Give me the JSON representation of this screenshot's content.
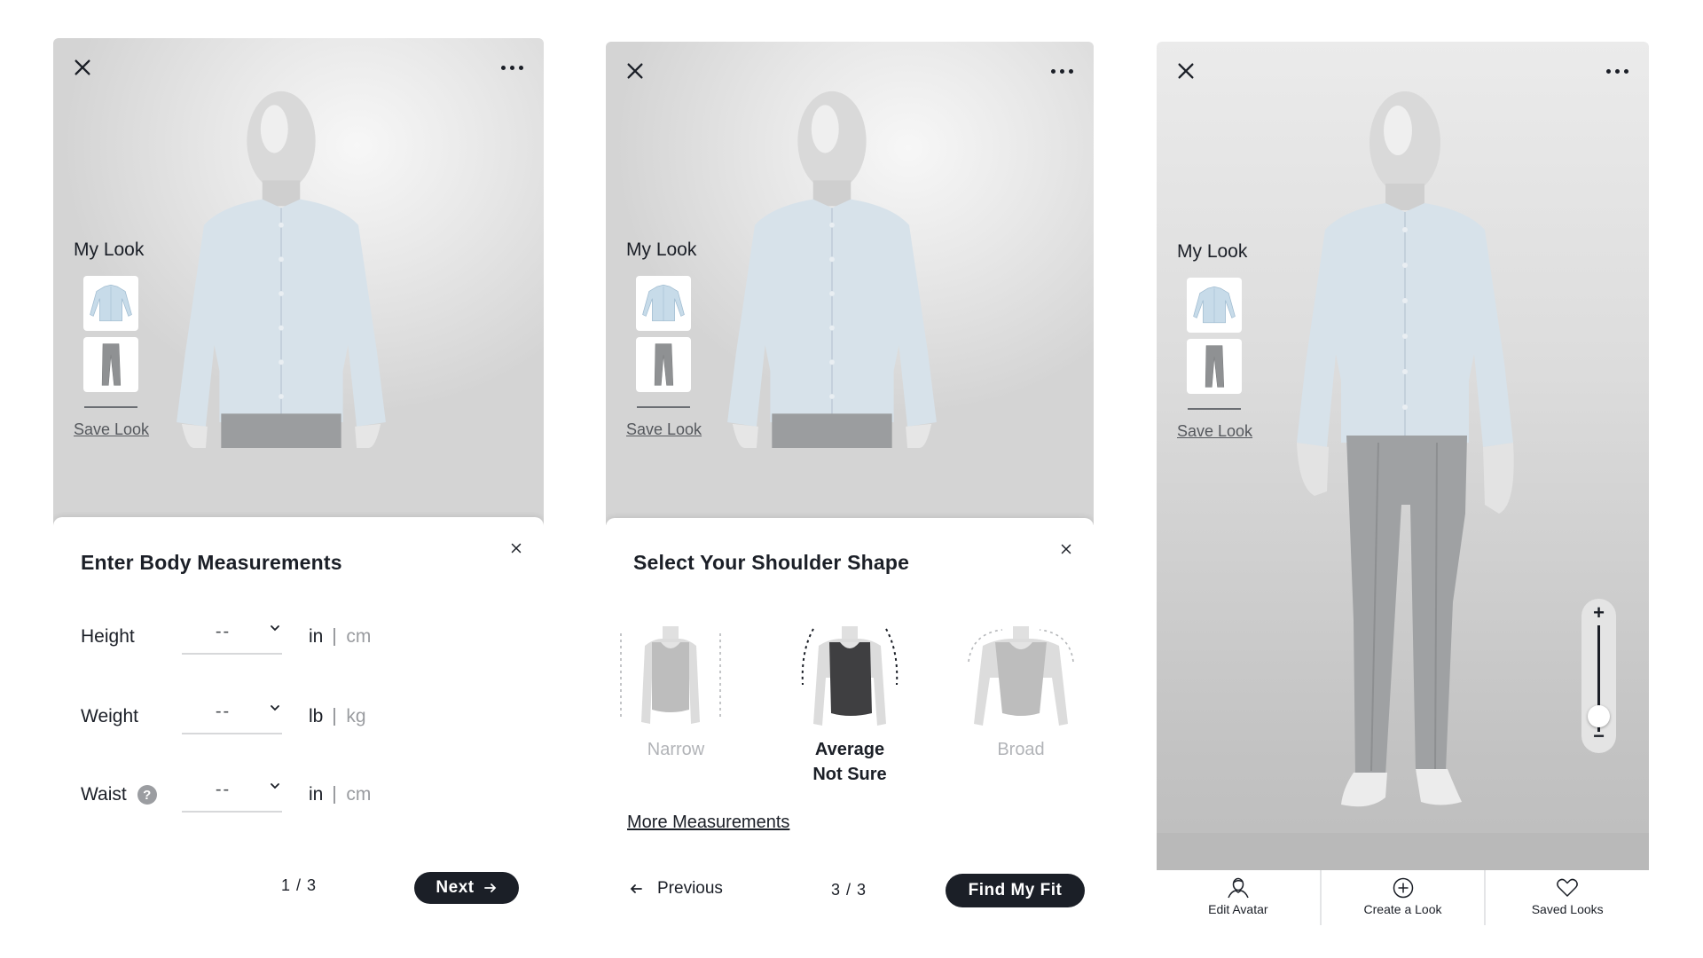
{
  "colors": {
    "primary": "#1b1f27",
    "muted": "#9a9ca0",
    "disabled": "#b2b4b8",
    "stage_bg": "#e6e6e6",
    "white": "#ffffff"
  },
  "common": {
    "close_icon": "close-icon",
    "more_icon": "more-horizontal-icon",
    "my_look_title": "My Look",
    "thumbnails": [
      {
        "name": "shirt",
        "icon": "shirt-thumbnail"
      },
      {
        "name": "pants",
        "icon": "pants-thumbnail"
      }
    ],
    "save_look": "Save Look"
  },
  "panel1": {
    "sheet_title": "Enter Body Measurements",
    "fields": [
      {
        "label": "Height",
        "value": "--",
        "help": false,
        "unit_active": "in",
        "unit_inactive": "cm"
      },
      {
        "label": "Weight",
        "value": "--",
        "help": false,
        "unit_active": "lb",
        "unit_inactive": "kg"
      },
      {
        "label": "Waist",
        "value": "--",
        "help": true,
        "help_glyph": "?",
        "unit_active": "in",
        "unit_inactive": "cm"
      }
    ],
    "pager": "1 / 3",
    "next_label": "Next",
    "next_icon": "arrow-right-icon"
  },
  "panel2": {
    "sheet_title": "Select Your Shoulder Shape",
    "shapes": [
      {
        "label": "Narrow",
        "sublabel": "",
        "selected": false
      },
      {
        "label": "Average",
        "sublabel": "Not Sure",
        "selected": true
      },
      {
        "label": "Broad",
        "sublabel": "",
        "selected": false
      }
    ],
    "more_measurements": "More Measurements",
    "previous_label": "Previous",
    "pager": "3 / 3",
    "find_fit_label": "Find My Fit"
  },
  "panel3": {
    "zoom": {
      "plus": "+",
      "minus": "−",
      "level": 0.15
    },
    "nav": [
      {
        "label": "Edit Avatar",
        "icon": "avatar-icon"
      },
      {
        "label": "Create a Look",
        "icon": "plus-circle-icon"
      },
      {
        "label": "Saved Looks",
        "icon": "heart-icon"
      }
    ]
  }
}
